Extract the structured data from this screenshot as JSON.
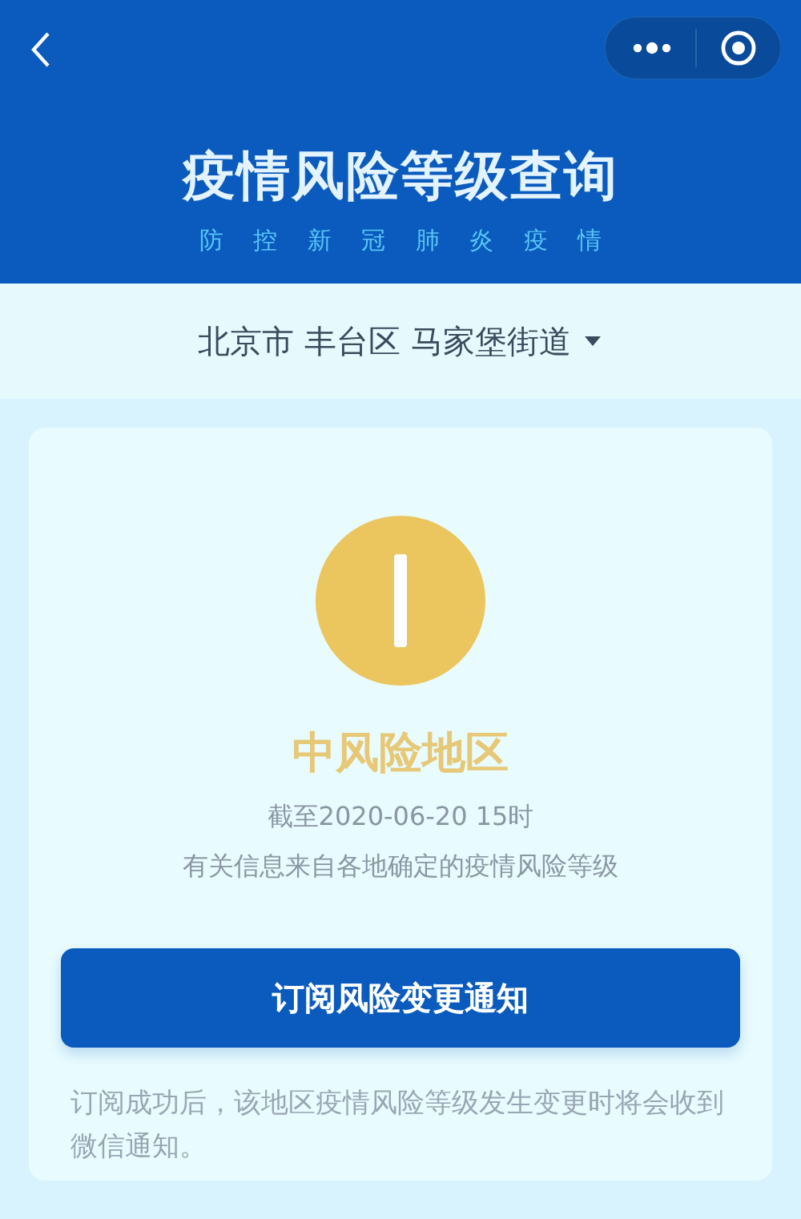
{
  "header": {
    "title": "疫情风险等级查询",
    "subtitle": "防 控 新 冠 肺 炎 疫 情"
  },
  "location": {
    "value": "北京市 丰台区 马家堡街道"
  },
  "result": {
    "kind": "medium",
    "label": "中风险地区",
    "as_of": "截至2020-06-20 15时",
    "source": "有关信息来自各地确定的疫情风险等级"
  },
  "subscribe_button": "订阅风险变更通知",
  "note": "订阅成功后，该地区疫情风险等级发生变更时将会收到微信通知。"
}
